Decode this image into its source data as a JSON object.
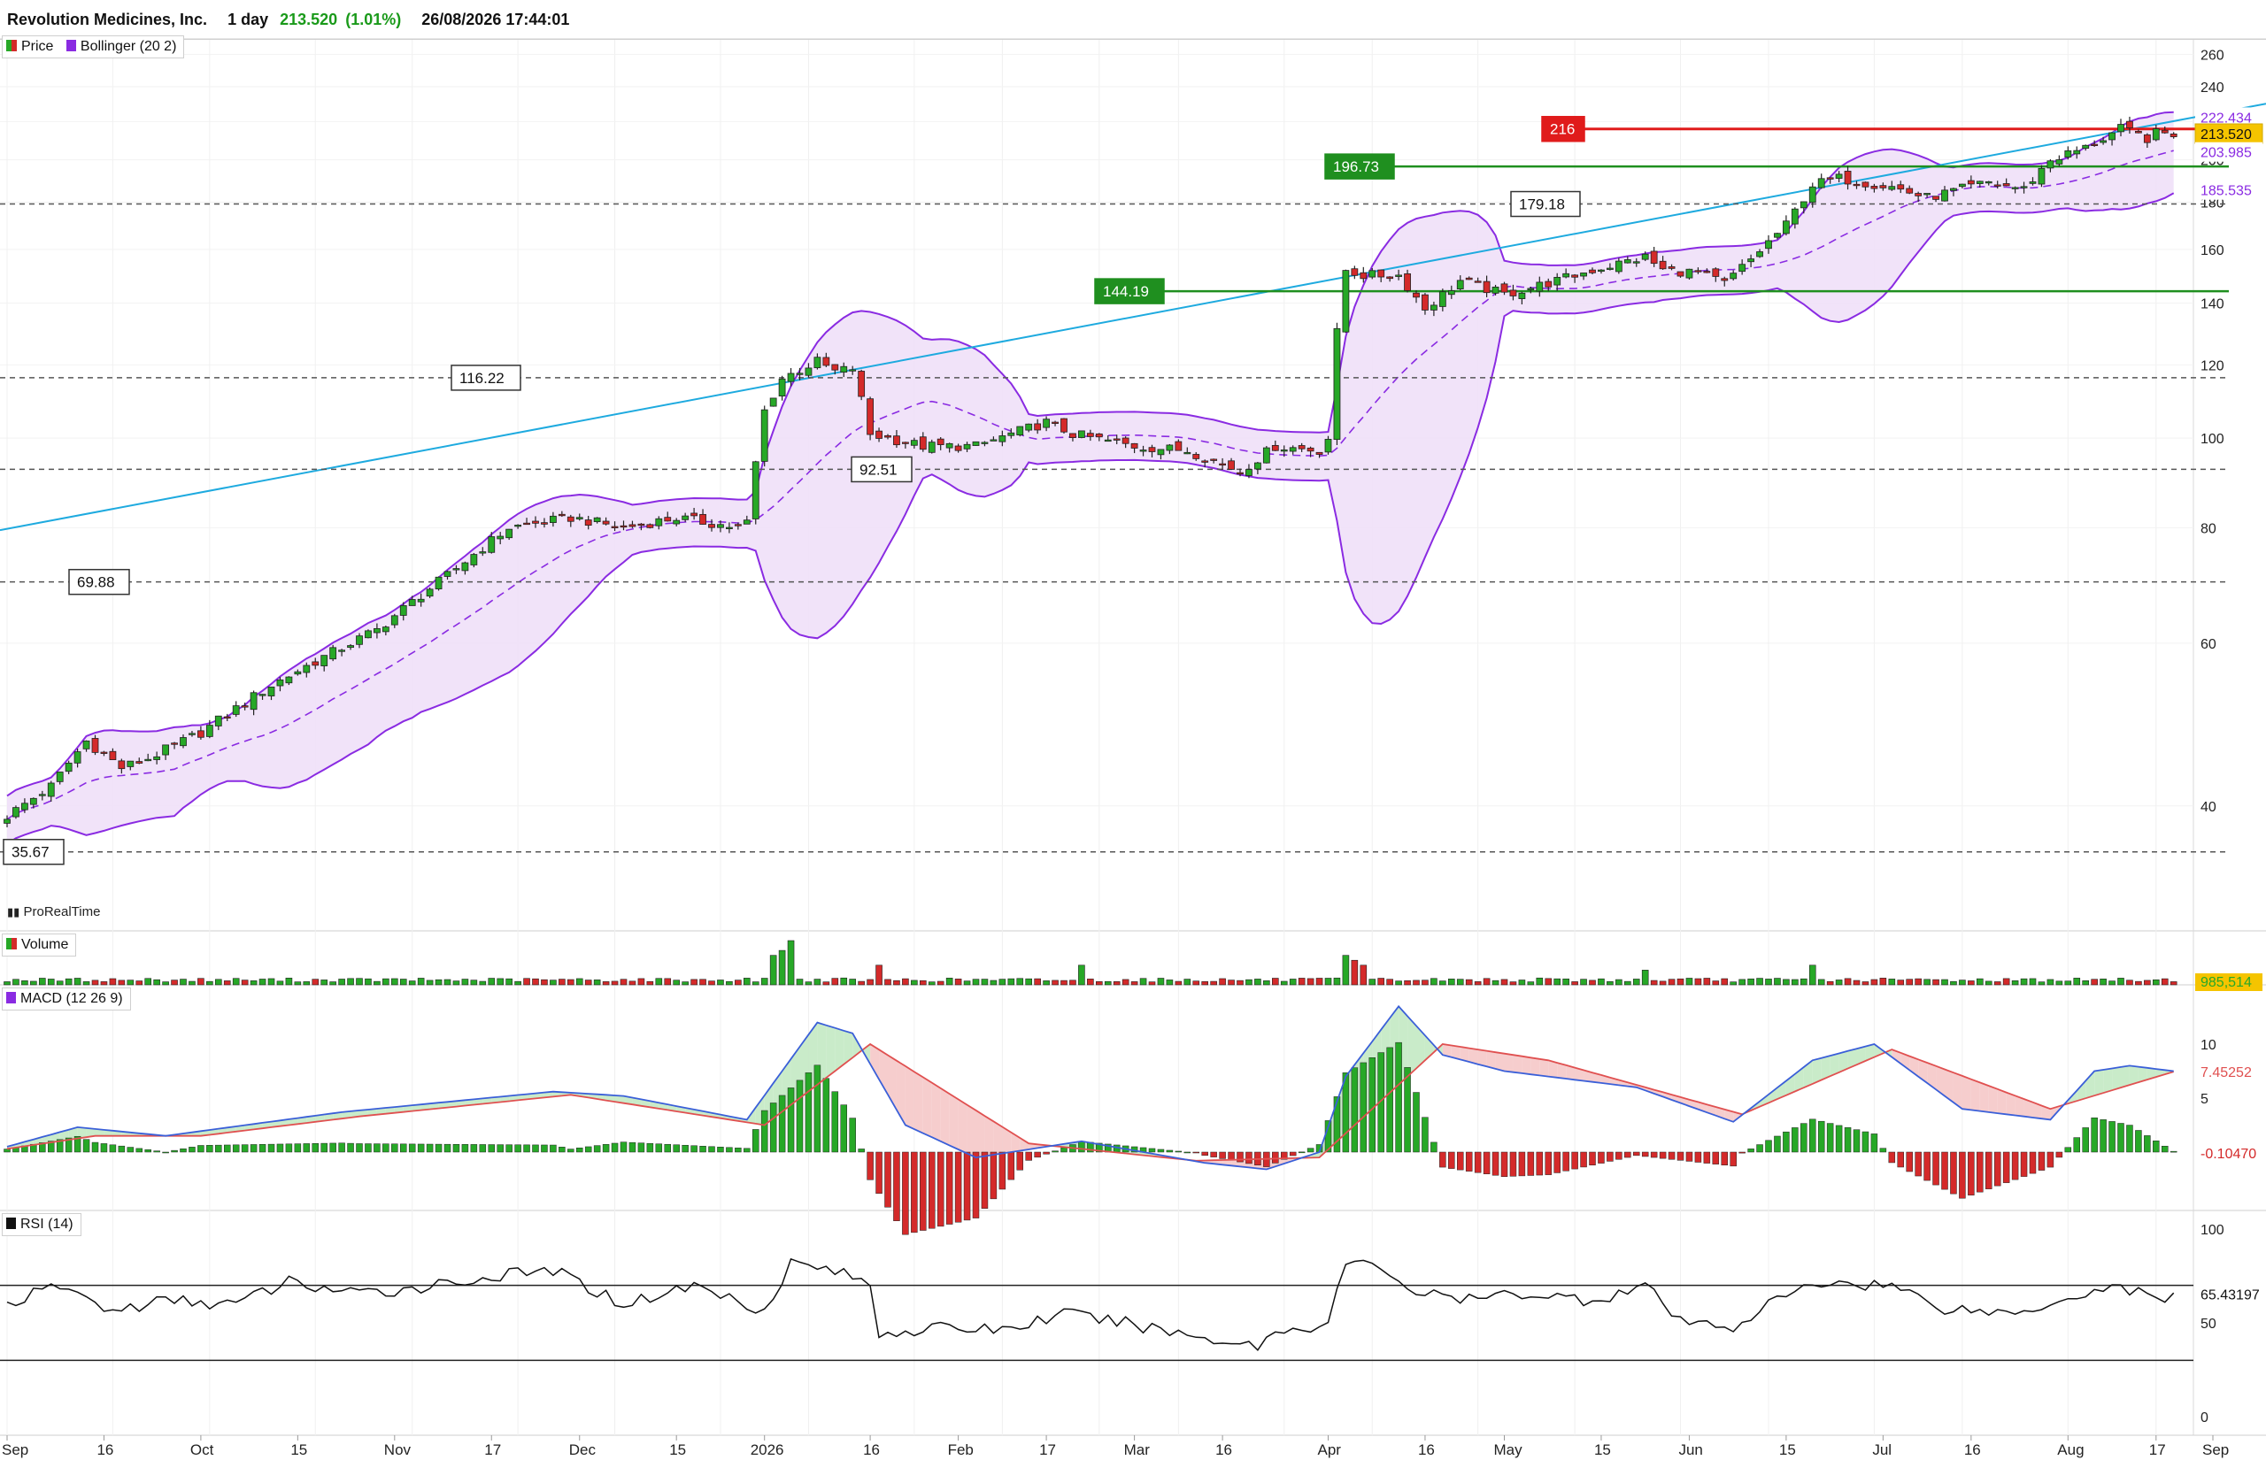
{
  "header": {
    "instrument": "Revolution Medicines, Inc.",
    "timeframe": "1 day",
    "price": "213.520",
    "change": "(1.01%)",
    "datetime": "26/08/2026 17:44:01"
  },
  "legends": {
    "price": "Price",
    "bollinger": "Bollinger (20 2)",
    "volume": "Volume",
    "macd": "MACD (12 26 9)",
    "rsi": "RSI (14)",
    "watermark": "ProRealTime"
  },
  "colors": {
    "up": "#27a827",
    "down": "#d42a2a",
    "bollinger": "#8a2be2",
    "bollinger_fill": "#f0e0f8",
    "trendline": "#1eaadf",
    "support_green": "#1f8f1f",
    "resistance_red": "#e01b1b",
    "current_price": "#f5c400",
    "macd_line": "#3a5fd8",
    "signal_line": "#e05050",
    "rsi_line": "#111111"
  },
  "chart_data": [
    {
      "type": "candlestick",
      "panel": "price",
      "y_scale": "log",
      "x_labels": [
        "Sep",
        "16",
        "Oct",
        "15",
        "Nov",
        "17",
        "Dec",
        "15",
        "2026",
        "16",
        "Feb",
        "17",
        "Mar",
        "16",
        "Apr",
        "16",
        "May",
        "15",
        "Jun",
        "15",
        "Jul",
        "16",
        "Aug",
        "17",
        "Sep"
      ],
      "y_ticks": [
        "260",
        "240",
        "220",
        "200",
        "180",
        "160",
        "140",
        "120",
        "100",
        "80",
        "60",
        "40"
      ],
      "ylim": [
        32,
        265
      ],
      "close_path": [
        {
          "i": 0,
          "v": 39
        },
        {
          "i": 5,
          "v": 42
        },
        {
          "i": 9,
          "v": 47
        },
        {
          "i": 13,
          "v": 44
        },
        {
          "i": 16,
          "v": 45
        },
        {
          "i": 22,
          "v": 48
        },
        {
          "i": 30,
          "v": 54
        },
        {
          "i": 36,
          "v": 58
        },
        {
          "i": 42,
          "v": 62
        },
        {
          "i": 50,
          "v": 71
        },
        {
          "i": 57,
          "v": 80
        },
        {
          "i": 64,
          "v": 82
        },
        {
          "i": 70,
          "v": 80
        },
        {
          "i": 76,
          "v": 82
        },
        {
          "i": 83,
          "v": 80
        },
        {
          "i": 84,
          "v": 81
        },
        {
          "i": 86,
          "v": 107
        },
        {
          "i": 88,
          "v": 116
        },
        {
          "i": 92,
          "v": 121
        },
        {
          "i": 94,
          "v": 118
        },
        {
          "i": 96,
          "v": 119
        },
        {
          "i": 98,
          "v": 101
        },
        {
          "i": 104,
          "v": 98
        },
        {
          "i": 110,
          "v": 98
        },
        {
          "i": 114,
          "v": 101
        },
        {
          "i": 118,
          "v": 104
        },
        {
          "i": 121,
          "v": 101
        },
        {
          "i": 128,
          "v": 98
        },
        {
          "i": 134,
          "v": 97
        },
        {
          "i": 140,
          "v": 92
        },
        {
          "i": 144,
          "v": 98
        },
        {
          "i": 149,
          "v": 97
        },
        {
          "i": 150,
          "v": 100
        },
        {
          "i": 151,
          "v": 130
        },
        {
          "i": 152,
          "v": 152
        },
        {
          "i": 154,
          "v": 150
        },
        {
          "i": 158,
          "v": 150
        },
        {
          "i": 161,
          "v": 138
        },
        {
          "i": 165,
          "v": 148
        },
        {
          "i": 170,
          "v": 143
        },
        {
          "i": 176,
          "v": 148
        },
        {
          "i": 180,
          "v": 152
        },
        {
          "i": 186,
          "v": 157
        },
        {
          "i": 188,
          "v": 152
        },
        {
          "i": 192,
          "v": 151
        },
        {
          "i": 195,
          "v": 147
        },
        {
          "i": 198,
          "v": 156
        },
        {
          "i": 202,
          "v": 170
        },
        {
          "i": 205,
          "v": 188
        },
        {
          "i": 208,
          "v": 191
        },
        {
          "i": 214,
          "v": 187
        },
        {
          "i": 218,
          "v": 182
        },
        {
          "i": 222,
          "v": 186
        },
        {
          "i": 225,
          "v": 189
        },
        {
          "i": 229,
          "v": 186
        },
        {
          "i": 232,
          "v": 200
        },
        {
          "i": 236,
          "v": 206
        },
        {
          "i": 240,
          "v": 216
        },
        {
          "i": 243,
          "v": 211
        },
        {
          "i": 244,
          "v": 213.52
        }
      ],
      "levels": [
        {
          "label": "216",
          "value": 216,
          "style": "resistance-red"
        },
        {
          "label": "196.73",
          "value": 196.73,
          "style": "support-green"
        },
        {
          "label": "179.18",
          "value": 179.18,
          "style": "dashed"
        },
        {
          "label": "144.19",
          "value": 144.19,
          "style": "support-green"
        },
        {
          "label": "116.22",
          "value": 116.22,
          "style": "dashed"
        },
        {
          "label": "92.51",
          "value": 92.51,
          "style": "dashed"
        },
        {
          "label": "69.88",
          "value": 69.88,
          "style": "dashed"
        },
        {
          "label": "35.67",
          "value": 35.67,
          "style": "dashed"
        }
      ],
      "right_labels": [
        {
          "text": "222.434",
          "kind": "bb-upper"
        },
        {
          "text": "213.520",
          "kind": "price"
        },
        {
          "text": "203.985",
          "kind": "bb-mid"
        },
        {
          "text": "185.535",
          "kind": "bb-lower"
        }
      ]
    },
    {
      "type": "bar",
      "panel": "volume",
      "right_labels": [
        {
          "text": "985,514",
          "kind": "volume"
        }
      ],
      "spikes": [
        {
          "i": 87,
          "v": 6
        },
        {
          "i": 88,
          "v": 7
        },
        {
          "i": 89,
          "v": 9
        },
        {
          "i": 99,
          "v": 4
        },
        {
          "i": 122,
          "v": 4
        },
        {
          "i": 152,
          "v": 6
        },
        {
          "i": 153,
          "v": 5
        },
        {
          "i": 154,
          "v": 4
        },
        {
          "i": 186,
          "v": 3
        },
        {
          "i": 205,
          "v": 4
        }
      ]
    },
    {
      "type": "line",
      "panel": "macd",
      "y_ticks": [
        "10",
        "5"
      ],
      "ylim": [
        -6,
        13
      ],
      "right_labels": [
        {
          "text": "7.45252",
          "kind": "signal"
        },
        {
          "text": "-0.10470",
          "kind": "histogram"
        }
      ],
      "macd_path": [
        {
          "i": 0,
          "v": 0.5
        },
        {
          "i": 8,
          "v": 2.3
        },
        {
          "i": 18,
          "v": 1.5
        },
        {
          "i": 38,
          "v": 3.7
        },
        {
          "i": 62,
          "v": 5.6
        },
        {
          "i": 70,
          "v": 5.2
        },
        {
          "i": 84,
          "v": 3.0
        },
        {
          "i": 92,
          "v": 12.0
        },
        {
          "i": 96,
          "v": 11.0
        },
        {
          "i": 102,
          "v": 2.5
        },
        {
          "i": 110,
          "v": -0.5
        },
        {
          "i": 122,
          "v": 1.0
        },
        {
          "i": 136,
          "v": -1.0
        },
        {
          "i": 143,
          "v": -1.6
        },
        {
          "i": 149,
          "v": 0.0
        },
        {
          "i": 152,
          "v": 7.0
        },
        {
          "i": 158,
          "v": 13.5
        },
        {
          "i": 163,
          "v": 9.0
        },
        {
          "i": 170,
          "v": 7.5
        },
        {
          "i": 185,
          "v": 6.0
        },
        {
          "i": 196,
          "v": 2.8
        },
        {
          "i": 205,
          "v": 8.5
        },
        {
          "i": 212,
          "v": 10.0
        },
        {
          "i": 222,
          "v": 4.0
        },
        {
          "i": 232,
          "v": 3.0
        },
        {
          "i": 237,
          "v": 7.5
        },
        {
          "i": 241,
          "v": 8.0
        },
        {
          "i": 246,
          "v": 7.5
        }
      ],
      "signal_path": [
        {
          "i": 0,
          "v": 0.3
        },
        {
          "i": 10,
          "v": 1.5
        },
        {
          "i": 22,
          "v": 1.5
        },
        {
          "i": 40,
          "v": 3.3
        },
        {
          "i": 64,
          "v": 5.3
        },
        {
          "i": 86,
          "v": 2.5
        },
        {
          "i": 98,
          "v": 10.0
        },
        {
          "i": 116,
          "v": 0.8
        },
        {
          "i": 135,
          "v": -0.8
        },
        {
          "i": 149,
          "v": -0.5
        },
        {
          "i": 163,
          "v": 10.0
        },
        {
          "i": 175,
          "v": 8.5
        },
        {
          "i": 197,
          "v": 3.5
        },
        {
          "i": 214,
          "v": 9.5
        },
        {
          "i": 232,
          "v": 4.0
        },
        {
          "i": 246,
          "v": 7.45
        }
      ]
    },
    {
      "type": "line",
      "panel": "rsi",
      "y_ticks": [
        "100",
        "50",
        "0"
      ],
      "ylim": [
        0,
        100
      ],
      "guides": [
        70,
        30
      ],
      "right_labels": [
        {
          "text": "65.43197",
          "kind": "rsi"
        }
      ],
      "rsi_path": [
        {
          "i": 0,
          "v": 60
        },
        {
          "i": 6,
          "v": 70
        },
        {
          "i": 12,
          "v": 56
        },
        {
          "i": 18,
          "v": 62
        },
        {
          "i": 26,
          "v": 60
        },
        {
          "i": 32,
          "v": 72
        },
        {
          "i": 40,
          "v": 65
        },
        {
          "i": 48,
          "v": 70
        },
        {
          "i": 56,
          "v": 75
        },
        {
          "i": 62,
          "v": 78
        },
        {
          "i": 70,
          "v": 60
        },
        {
          "i": 78,
          "v": 70
        },
        {
          "i": 86,
          "v": 57
        },
        {
          "i": 89,
          "v": 82
        },
        {
          "i": 94,
          "v": 78
        },
        {
          "i": 98,
          "v": 70
        },
        {
          "i": 99,
          "v": 45
        },
        {
          "i": 106,
          "v": 47
        },
        {
          "i": 114,
          "v": 47
        },
        {
          "i": 120,
          "v": 55
        },
        {
          "i": 128,
          "v": 49
        },
        {
          "i": 136,
          "v": 42
        },
        {
          "i": 142,
          "v": 38
        },
        {
          "i": 144,
          "v": 45
        },
        {
          "i": 150,
          "v": 50
        },
        {
          "i": 152,
          "v": 82
        },
        {
          "i": 156,
          "v": 80
        },
        {
          "i": 160,
          "v": 66
        },
        {
          "i": 166,
          "v": 62
        },
        {
          "i": 172,
          "v": 66
        },
        {
          "i": 180,
          "v": 62
        },
        {
          "i": 186,
          "v": 70
        },
        {
          "i": 190,
          "v": 50
        },
        {
          "i": 196,
          "v": 48
        },
        {
          "i": 202,
          "v": 65
        },
        {
          "i": 207,
          "v": 72
        },
        {
          "i": 214,
          "v": 70
        },
        {
          "i": 220,
          "v": 58
        },
        {
          "i": 228,
          "v": 55
        },
        {
          "i": 234,
          "v": 64
        },
        {
          "i": 240,
          "v": 70
        },
        {
          "i": 244,
          "v": 62
        },
        {
          "i": 246,
          "v": 65.43
        }
      ]
    }
  ]
}
